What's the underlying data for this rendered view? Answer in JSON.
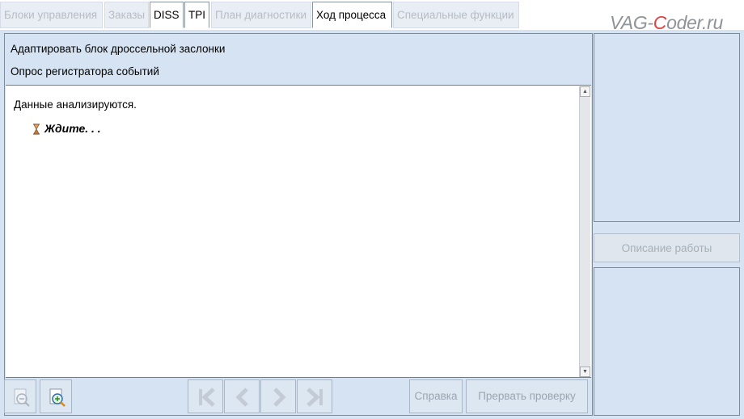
{
  "tabs": [
    {
      "label": "Блоки управления",
      "active": false
    },
    {
      "label": "Заказы",
      "active": false
    },
    {
      "label": "DISS",
      "active": true
    },
    {
      "label": "TPI",
      "active": true
    },
    {
      "label": "План диагностики",
      "active": false
    },
    {
      "label": "Ход процесса",
      "active": true
    },
    {
      "label": "Специальные функции",
      "active": false
    }
  ],
  "watermark": {
    "pre": "VAG-",
    "c": "C",
    "post": "oder.ru"
  },
  "header": {
    "line1": "Адаптировать блок дроссельной заслонки",
    "line2": "Опрос регистратора событий"
  },
  "content": {
    "message": "Данные анализируются.",
    "wait": "Ждите. . ."
  },
  "buttons": {
    "help": "Справка",
    "abort": "Прервать проверку",
    "description": "Описание работы"
  },
  "icons": {
    "zoom_out": "zoom-out-icon",
    "zoom_in": "zoom-in-icon",
    "first": "first-page-icon",
    "prev": "previous-icon",
    "next": "next-icon",
    "last": "last-page-icon",
    "hourglass": "hourglass-icon"
  },
  "colors": {
    "background": "#d5e3f3",
    "content": "#ffffff",
    "disabled_text": "#9aa5b1",
    "watermark_accent": "#dd4444"
  }
}
